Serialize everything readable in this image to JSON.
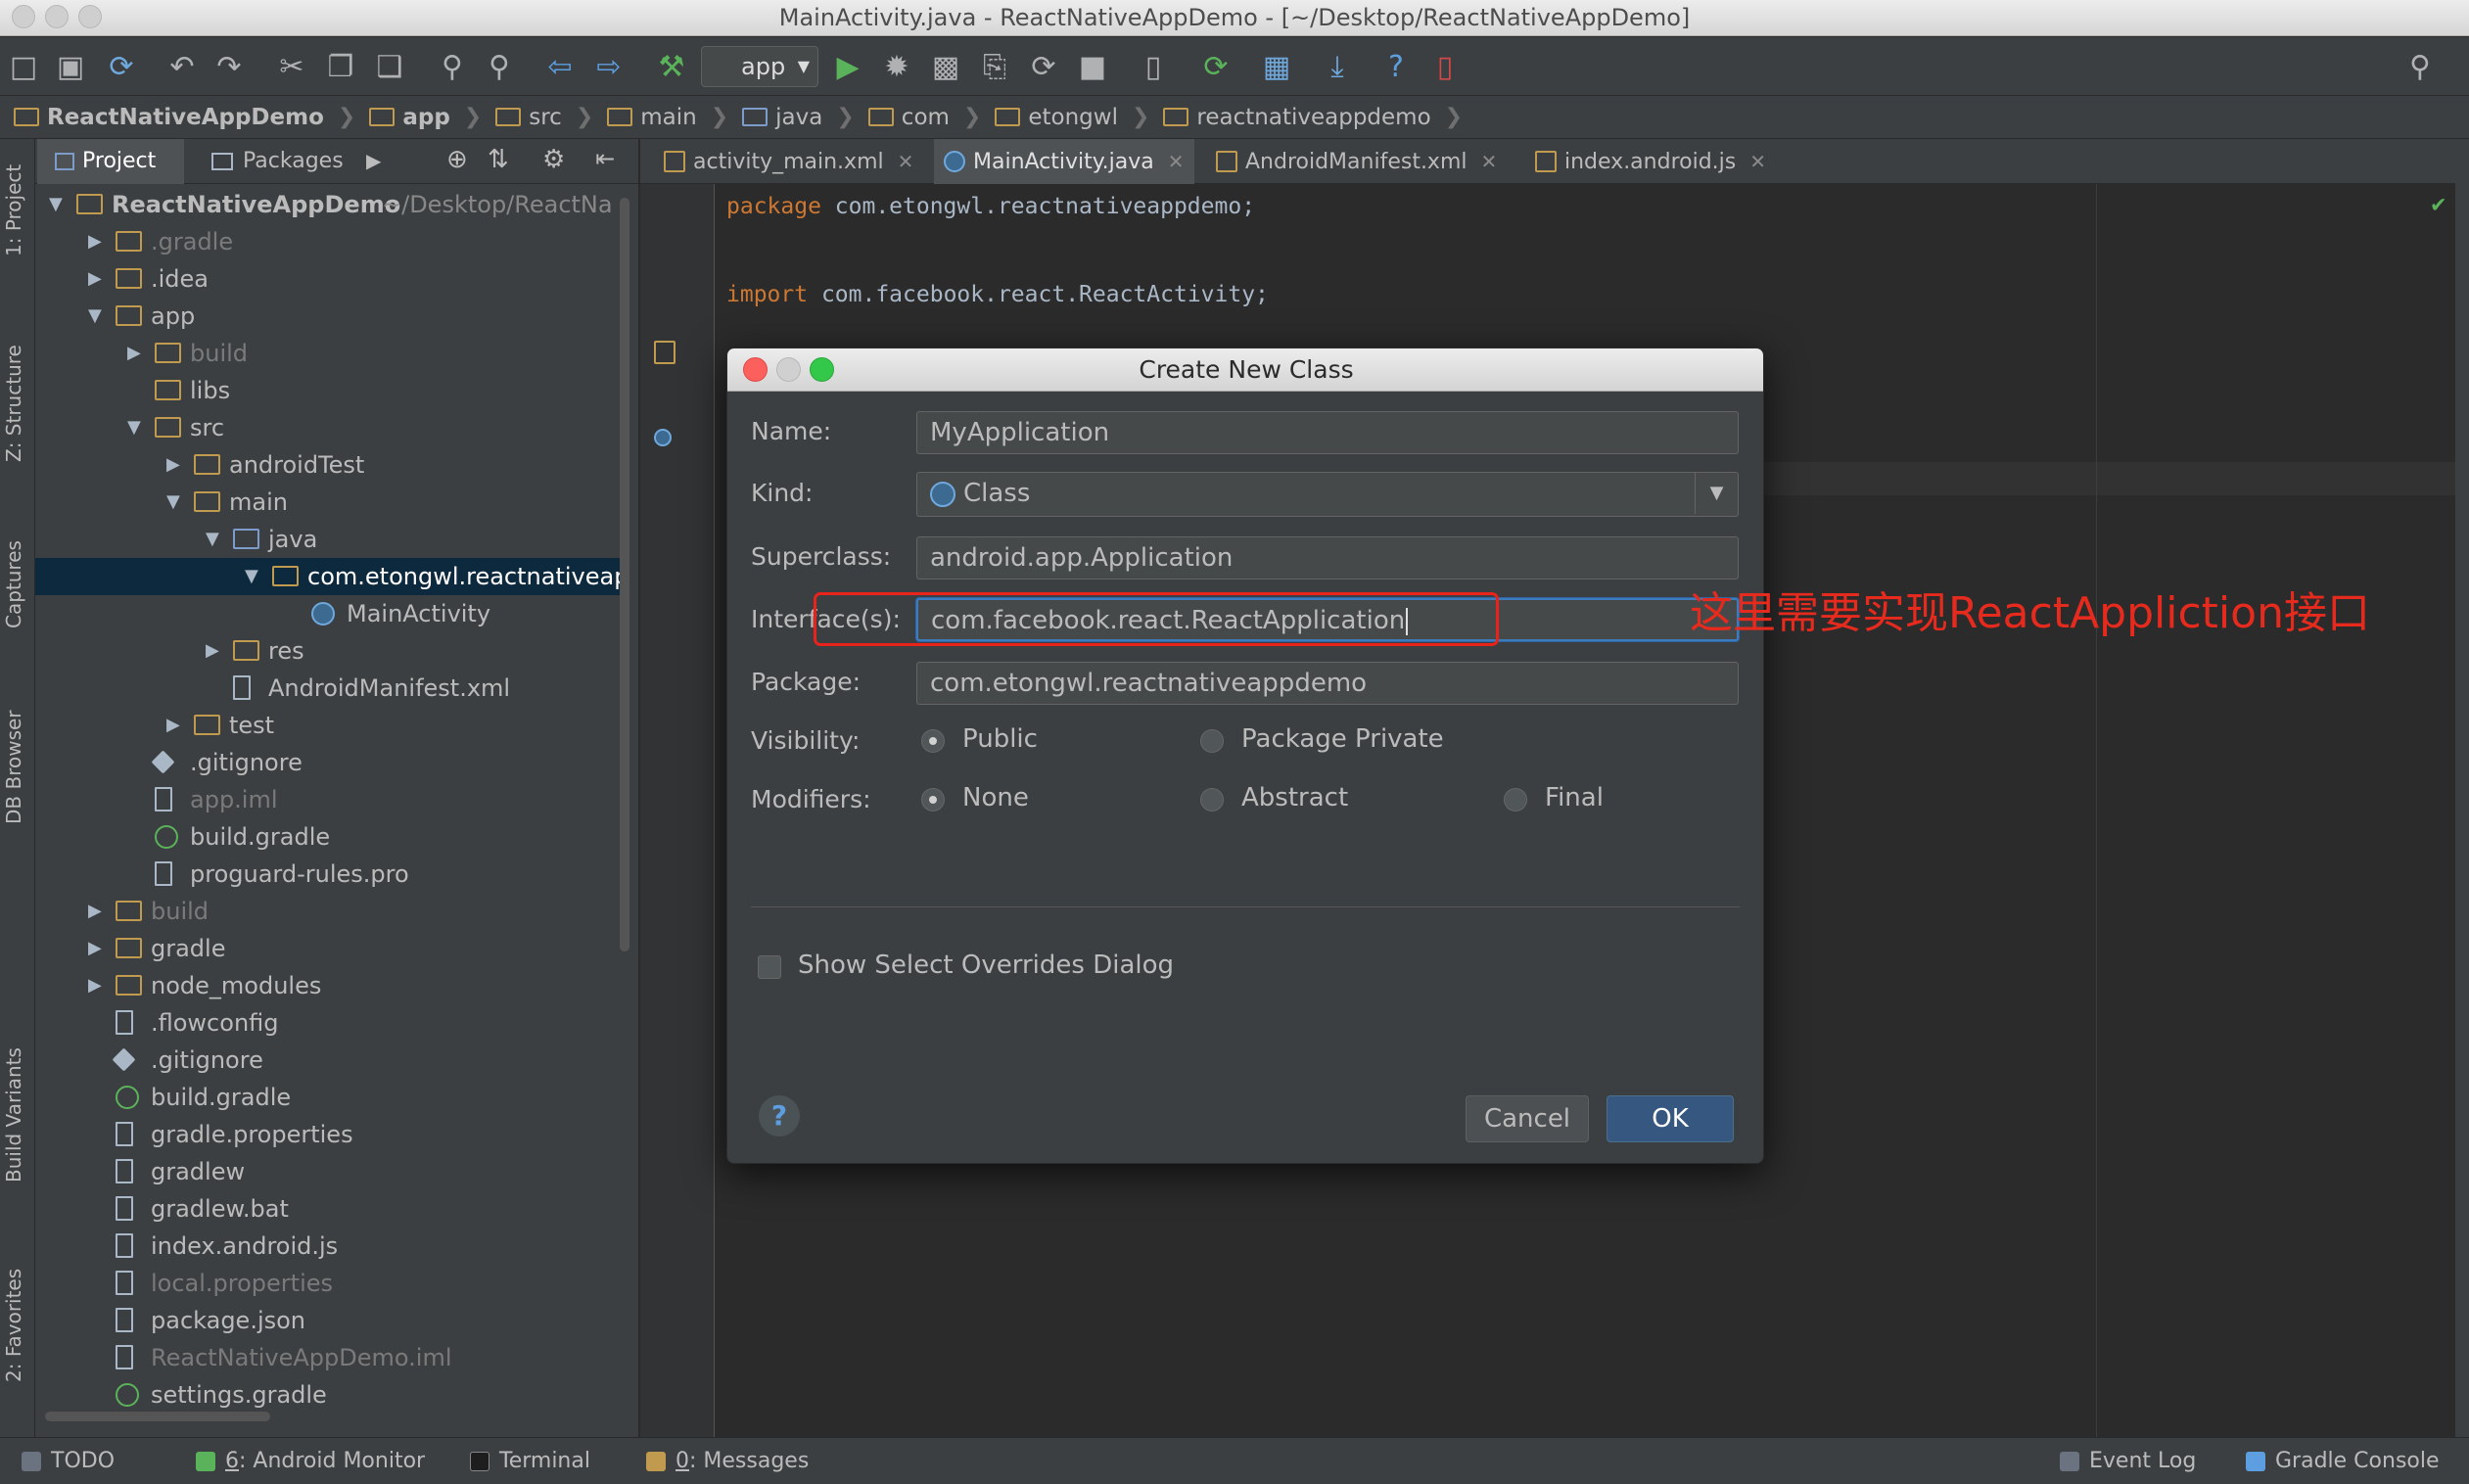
{
  "window": {
    "title": "MainActivity.java - ReactNativeAppDemo - [~/Desktop/ReactNativeAppDemo]"
  },
  "toolbar": {
    "run_config": "app",
    "icons": [
      "open-folder-icon",
      "save-icon",
      "sync-icon",
      "undo-icon",
      "redo-icon",
      "cut-icon",
      "copy-icon",
      "paste-icon",
      "find-icon",
      "replace-icon",
      "back-icon",
      "forward-icon",
      "make-icon",
      "run-icon",
      "debug-icon",
      "coverage-icon",
      "attach-icon",
      "rerun-icon",
      "stop-icon",
      "avd-icon",
      "gradle-sync-icon",
      "project-structure-icon",
      "sdk-icon",
      "help-icon",
      "device-icon",
      "search-everywhere-icon"
    ]
  },
  "breadcrumb": [
    "ReactNativeAppDemo",
    "app",
    "src",
    "main",
    "java",
    "com",
    "etongwl",
    "reactnativeappdemo"
  ],
  "left_strip": [
    "1: Project",
    "Z: Structure",
    "Captures",
    "DB Browser",
    "Build Variants",
    "2: Favorites"
  ],
  "project_panel": {
    "tabs": [
      "Project",
      "Packages"
    ],
    "tree": [
      {
        "label": "ReactNativeAppDemo",
        "suffix": "~/Desktop/ReactNa",
        "depth": 0,
        "arrow": "down",
        "icon": "folder"
      },
      {
        "label": ".gradle",
        "depth": 1,
        "arrow": "right",
        "icon": "folder",
        "dim": true
      },
      {
        "label": ".idea",
        "depth": 1,
        "arrow": "right",
        "icon": "folder"
      },
      {
        "label": "app",
        "depth": 1,
        "arrow": "down",
        "icon": "folder"
      },
      {
        "label": "build",
        "depth": 2,
        "arrow": "right",
        "icon": "folder",
        "dim": true
      },
      {
        "label": "libs",
        "depth": 2,
        "arrow": "",
        "icon": "folder"
      },
      {
        "label": "src",
        "depth": 2,
        "arrow": "down",
        "icon": "folder"
      },
      {
        "label": "androidTest",
        "depth": 3,
        "arrow": "right",
        "icon": "folder"
      },
      {
        "label": "main",
        "depth": 3,
        "arrow": "down",
        "icon": "folder"
      },
      {
        "label": "java",
        "depth": 4,
        "arrow": "down",
        "icon": "java"
      },
      {
        "label": "com.etongwl.reactnativeap",
        "depth": 5,
        "arrow": "down",
        "icon": "folder",
        "selected": true
      },
      {
        "label": "MainActivity",
        "depth": 6,
        "arrow": "",
        "icon": "cls"
      },
      {
        "label": "res",
        "depth": 4,
        "arrow": "right",
        "icon": "folder"
      },
      {
        "label": "AndroidManifest.xml",
        "depth": 4,
        "arrow": "",
        "icon": "file"
      },
      {
        "label": "test",
        "depth": 3,
        "arrow": "right",
        "icon": "folder"
      },
      {
        "label": ".gitignore",
        "depth": 2,
        "arrow": "",
        "icon": "git"
      },
      {
        "label": "app.iml",
        "depth": 2,
        "arrow": "",
        "icon": "file",
        "dim": true
      },
      {
        "label": "build.gradle",
        "depth": 2,
        "arrow": "",
        "icon": "grad"
      },
      {
        "label": "proguard-rules.pro",
        "depth": 2,
        "arrow": "",
        "icon": "file"
      },
      {
        "label": "build",
        "depth": 1,
        "arrow": "right",
        "icon": "folder",
        "dim": true
      },
      {
        "label": "gradle",
        "depth": 1,
        "arrow": "right",
        "icon": "folder"
      },
      {
        "label": "node_modules",
        "depth": 1,
        "arrow": "right",
        "icon": "folder"
      },
      {
        "label": ".flowconfig",
        "depth": 1,
        "arrow": "",
        "icon": "file"
      },
      {
        "label": ".gitignore",
        "depth": 1,
        "arrow": "",
        "icon": "git"
      },
      {
        "label": "build.gradle",
        "depth": 1,
        "arrow": "",
        "icon": "grad"
      },
      {
        "label": "gradle.properties",
        "depth": 1,
        "arrow": "",
        "icon": "file"
      },
      {
        "label": "gradlew",
        "depth": 1,
        "arrow": "",
        "icon": "file"
      },
      {
        "label": "gradlew.bat",
        "depth": 1,
        "arrow": "",
        "icon": "file"
      },
      {
        "label": "index.android.js",
        "depth": 1,
        "arrow": "",
        "icon": "file"
      },
      {
        "label": "local.properties",
        "depth": 1,
        "arrow": "",
        "icon": "file",
        "dim": true
      },
      {
        "label": "package.json",
        "depth": 1,
        "arrow": "",
        "icon": "file"
      },
      {
        "label": "ReactNativeAppDemo.iml",
        "depth": 1,
        "arrow": "",
        "icon": "file",
        "dim": true
      },
      {
        "label": "settings.gradle",
        "depth": 1,
        "arrow": "",
        "icon": "grad"
      }
    ]
  },
  "editor_tabs": [
    {
      "label": "activity_main.xml"
    },
    {
      "label": "MainActivity.java",
      "active": true
    },
    {
      "label": "AndroidManifest.xml"
    },
    {
      "label": "index.android.js"
    }
  ],
  "code": {
    "line1_kw": "package",
    "line1_rest": " com.etongwl.reactnativeappdemo;",
    "line2_kw": "import",
    "line2_rest": " com.facebook.react.ReactActivity;"
  },
  "dialog": {
    "title": "Create New Class",
    "name_label": "Name:",
    "name_value": "MyApplication",
    "kind_label": "Kind:",
    "kind_value": "Class",
    "superclass_label": "Superclass:",
    "superclass_value": "android.app.Application",
    "interfaces_label": "Interface(s):",
    "interfaces_value": "com.facebook.react.ReactApplication",
    "package_label": "Package:",
    "package_value": "com.etongwl.reactnativeappdemo",
    "visibility_label": "Visibility:",
    "visibility_public": "Public",
    "visibility_package_private": "Package Private",
    "modifiers_label": "Modifiers:",
    "modifier_none": "None",
    "modifier_abstract": "Abstract",
    "modifier_final": "Final",
    "overrides_label": "Show Select Overrides Dialog",
    "cancel": "Cancel",
    "ok": "OK"
  },
  "annotation": {
    "text": "这里需要实现ReactAppliction接口",
    "color": "#e62b1e"
  },
  "status_bar": {
    "todo": "TODO",
    "android_monitor_key": "6",
    "android_monitor": ": Android Monitor",
    "terminal": "Terminal",
    "messages_key": "0",
    "messages": ": Messages",
    "event_log": "Event Log",
    "gradle_console": "Gradle Console"
  }
}
